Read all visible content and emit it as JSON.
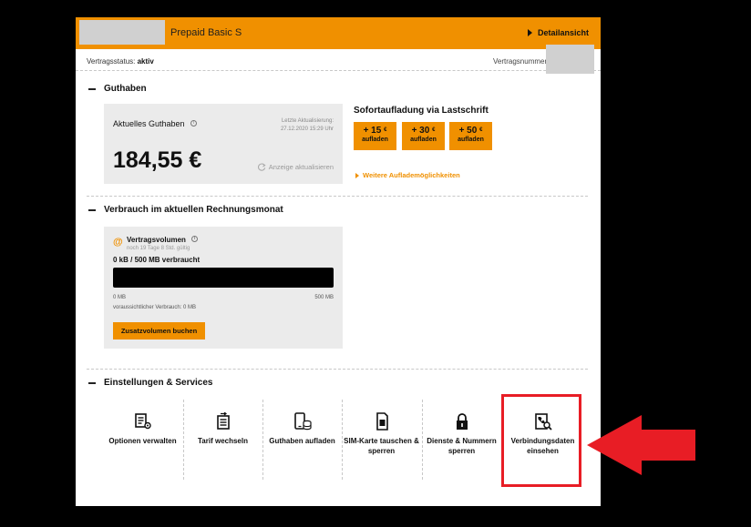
{
  "header": {
    "plan_name": "Prepaid Basic S",
    "detail_link": "Detailansicht"
  },
  "status": {
    "status_label": "Vertragsstatus:",
    "status_value": "aktiv",
    "contract_label": "Vertragsnummer"
  },
  "guthaben": {
    "section_title": "Guthaben",
    "current_label": "Aktuelles Guthaben",
    "last_update_label": "Letzte Aktualisierung:",
    "last_update_value": "27.12.2020 15:29 Uhr",
    "amount": "184,55 €",
    "refresh_label": "Anzeige aktualisieren",
    "sofort_title": "Sofortaufladung via Lastschrift",
    "topups": [
      {
        "amount": "+ 15",
        "currency": "€",
        "label": "aufladen"
      },
      {
        "amount": "+ 30",
        "currency": "€",
        "label": "aufladen"
      },
      {
        "amount": "+ 50",
        "currency": "€",
        "label": "aufladen"
      }
    ],
    "more_options": "Weitere Auflademöglichkeiten"
  },
  "verbrauch": {
    "section_title": "Verbrauch im aktuellen Rechnungsmonat",
    "volume_title": "Vertragsvolumen",
    "volume_sub": "noch 19 Tage 8 Std. gültig",
    "used_text": "0 kB / 500 MB verbraucht",
    "used_fraction": 0,
    "min_label": "0 MB",
    "max_label": "500 MB",
    "expected": "voraussichtlicher Verbrauch: 0 MB",
    "book_button": "Zusatzvolumen buchen"
  },
  "services": {
    "section_title": "Einstellungen & Services",
    "items": [
      {
        "label": "Optionen verwalten",
        "icon": "options-icon"
      },
      {
        "label": "Tarif wechseln",
        "icon": "tariff-switch-icon"
      },
      {
        "label": "Guthaben aufladen",
        "icon": "phone-coins-icon"
      },
      {
        "label": "SIM-Karte tauschen & sperren",
        "icon": "sim-card-icon"
      },
      {
        "label": "Dienste & Nummern sperren",
        "icon": "lock-icon"
      },
      {
        "label": "Verbindungsdaten einsehen",
        "icon": "document-search-icon"
      }
    ]
  },
  "colors": {
    "accent": "#f09000",
    "highlight": "#e81d25"
  }
}
